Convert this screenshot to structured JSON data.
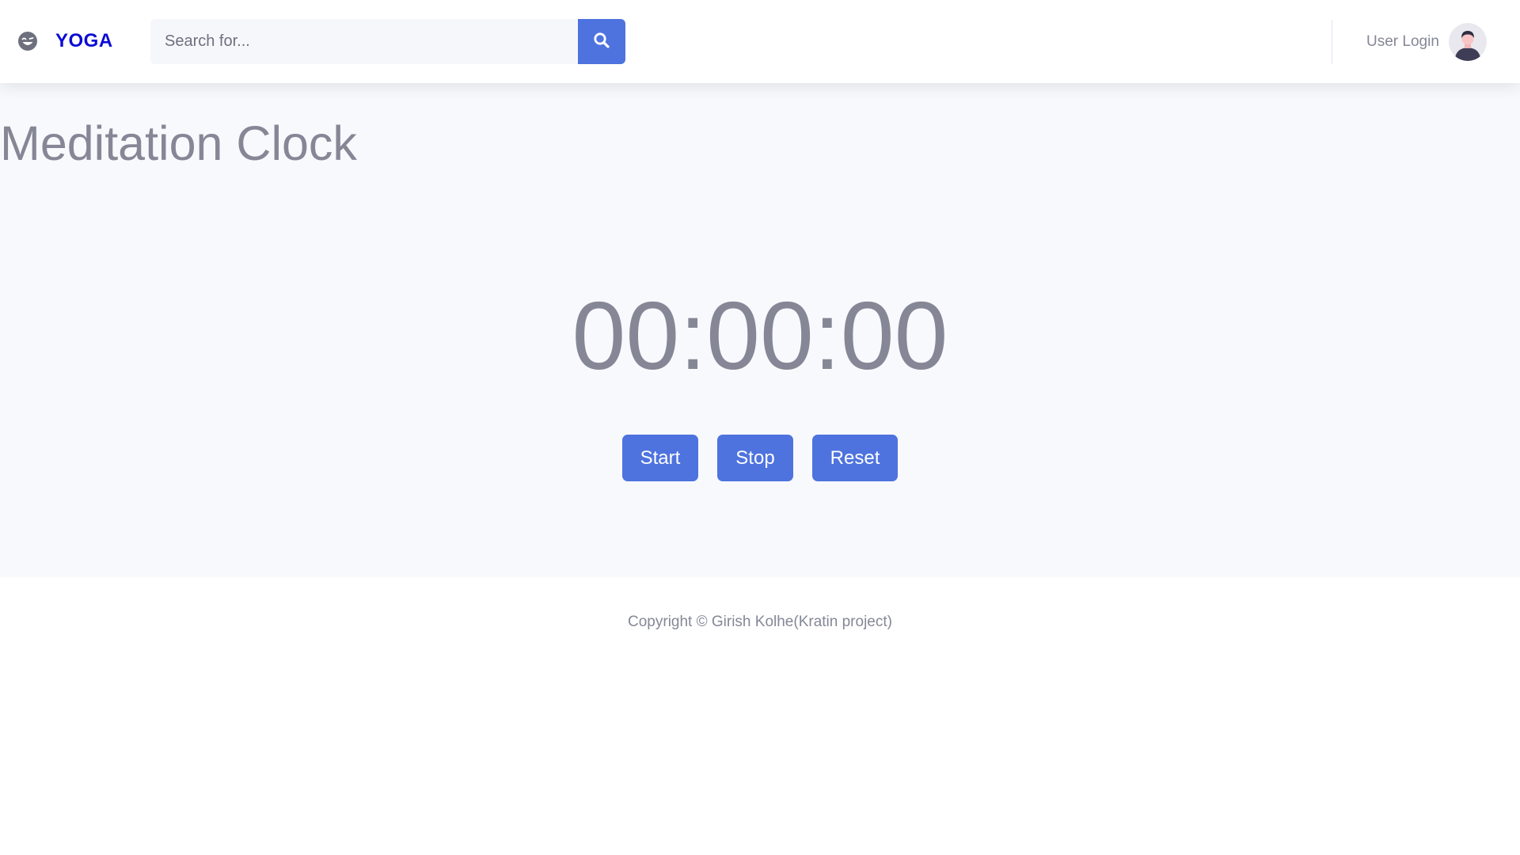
{
  "header": {
    "brand_icon": "laughing-wink-icon",
    "brand_name": "YOGA",
    "brand_color": "#0b0bd6",
    "search": {
      "placeholder": "Search for...",
      "value": "",
      "button_icon": "search-icon"
    },
    "user": {
      "label": "User Login",
      "avatar_icon": "user-avatar-icon"
    }
  },
  "main": {
    "title": "Meditation Clock",
    "clock": "00:00:00",
    "buttons": {
      "start": "Start",
      "stop": "Stop",
      "reset": "Reset"
    }
  },
  "footer": {
    "copyright": "Copyright © Girish Kolhe(Kratin project)"
  },
  "colors": {
    "accent": "#4e73df",
    "text_muted": "#858796",
    "content_bg": "#f8f9fc"
  }
}
